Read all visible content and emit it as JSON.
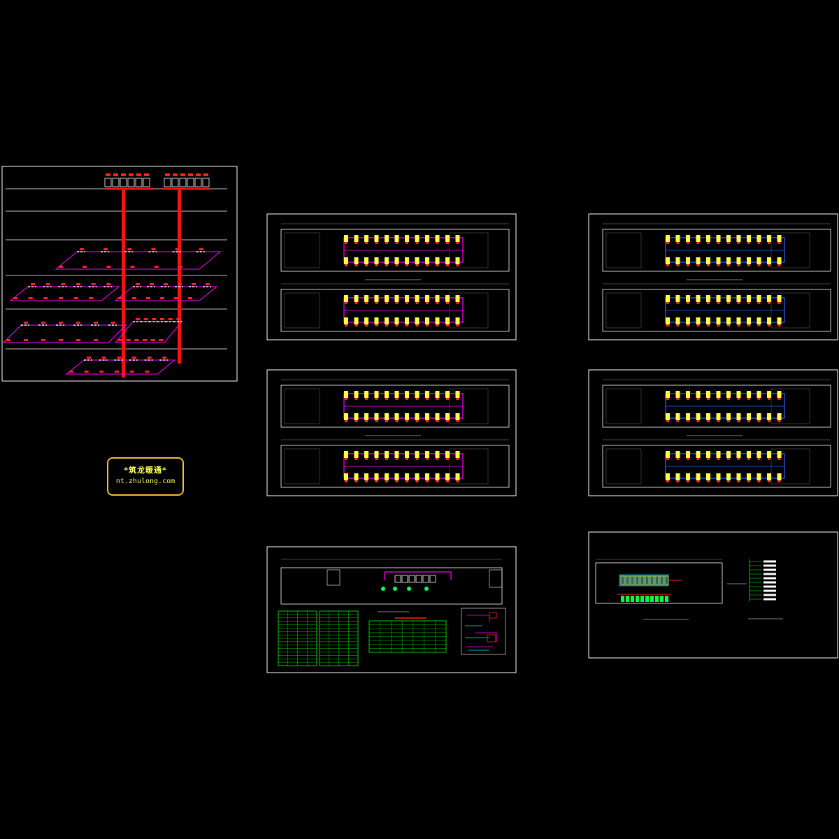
{
  "drawing": {
    "background": "#000000",
    "frame_color": "#ffffff",
    "pipe_color": "#ff2020",
    "duct_color": "#ff00ff",
    "unit_color": "#ffff40",
    "table_color": "#00ff00",
    "blue_color": "#3060ff"
  },
  "sheets": [
    {
      "id": "riser-diagram",
      "kind": "riser"
    },
    {
      "id": "plan-1",
      "kind": "floor-plan",
      "style": "magenta"
    },
    {
      "id": "plan-2",
      "kind": "floor-plan",
      "style": "blue"
    },
    {
      "id": "plan-3",
      "kind": "floor-plan",
      "style": "magenta"
    },
    {
      "id": "plan-4",
      "kind": "floor-plan",
      "style": "blue"
    },
    {
      "id": "equipment-schedule",
      "kind": "schedule"
    },
    {
      "id": "roof-plan",
      "kind": "roof"
    }
  ],
  "watermark": {
    "line1": "*筑龙暖通*",
    "line2": "nt.zhulong.com"
  }
}
